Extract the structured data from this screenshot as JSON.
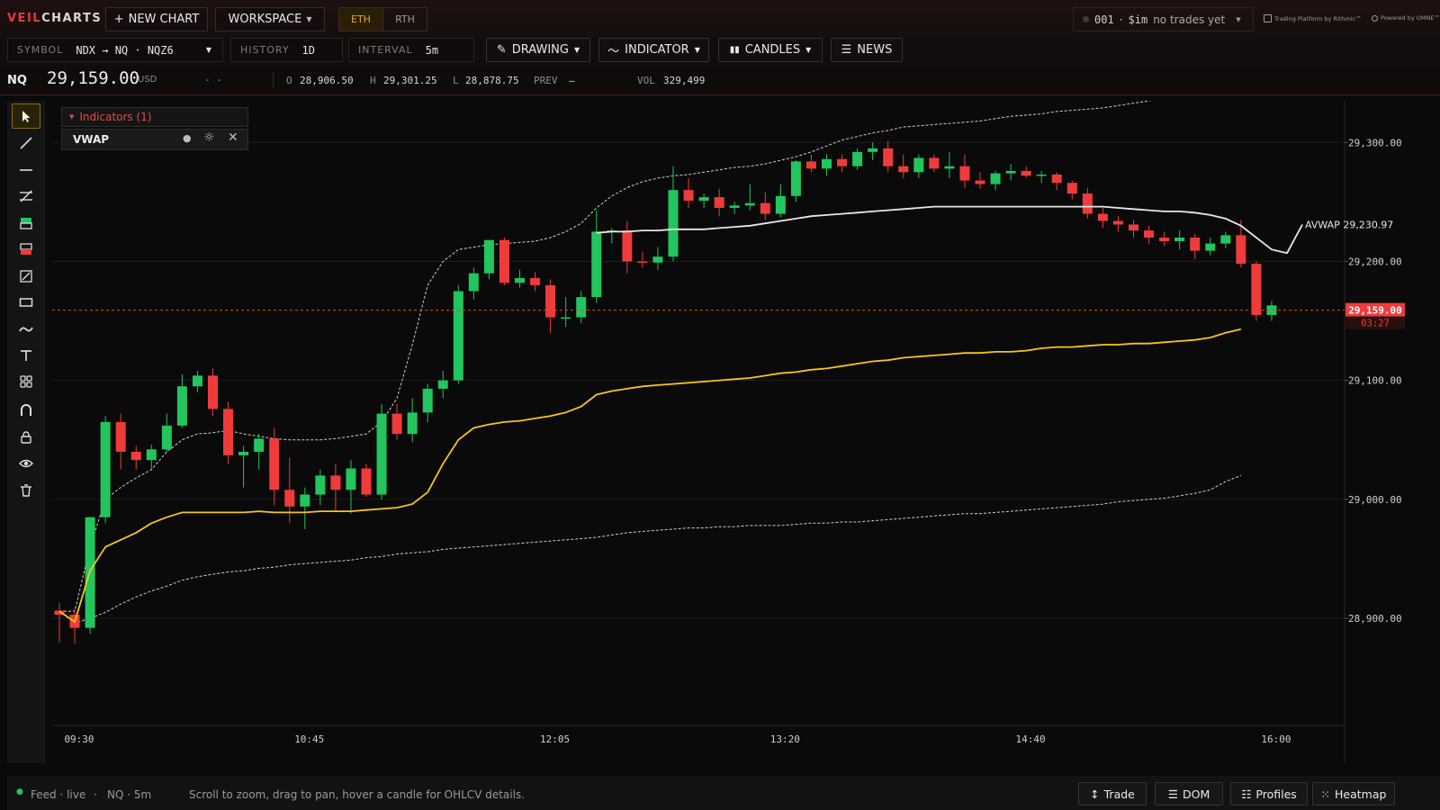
{
  "app": {
    "logo_accent": "VEIL",
    "logo_rest": "CHARTS"
  },
  "toolbar": {
    "new_chart": "NEW CHART",
    "workspace": "WORKSPACE",
    "session_eth": "ETH",
    "session_rth": "RTH",
    "account_id": "001",
    "account_sep": "·",
    "account_name": "$im",
    "account_status": "no trades yet",
    "brand_rithmic": "Trading Platform by Rithmic™",
    "brand_omne": "Powered by OMNE™"
  },
  "controls": {
    "symbol_label": "SYMBOL",
    "symbol_value": "NDX → NQ · NQZ6",
    "history_label": "HISTORY",
    "history_value": "1D",
    "interval_label": "INTERVAL",
    "interval_value": "5m",
    "drawing": "DRAWING",
    "indicator": "INDICATOR",
    "candles": "CANDLES",
    "news": "NEWS"
  },
  "quote": {
    "symbol": "NQ",
    "price": "29,159.00",
    "currency": "USD",
    "change": "- -",
    "o_label": "O",
    "o_value": "28,906.50",
    "h_label": "H",
    "h_value": "29,301.25",
    "l_label": "L",
    "l_value": "28,878.75",
    "prev_label": "PREV",
    "prev_value": "–",
    "vol_label": "VOL",
    "vol_value": "329,499"
  },
  "indicators": {
    "header": "Indicators (1)",
    "items": [
      {
        "name": "VWAP"
      }
    ]
  },
  "left_tools": [
    "cursor-icon",
    "trend-line-icon",
    "horizontal-line-icon",
    "parallel-channel-icon",
    "long-position-icon",
    "short-position-icon",
    "measure-icon",
    "rectangle-icon",
    "brush-icon",
    "text-icon",
    "patterns-icon",
    "magnet-icon",
    "lock-icon",
    "eye-icon",
    "trash-icon"
  ],
  "chart_data": {
    "type": "candlestick",
    "symbol": "NQ",
    "interval": "5m",
    "ylim": [
      28810,
      29335
    ],
    "y_ticks": [
      "29,300.00",
      "29,200.00",
      "29,100.00",
      "29,000.00",
      "28,900.00"
    ],
    "y_tick_values": [
      29300,
      29200,
      29100,
      29000,
      28900
    ],
    "x_ticks": [
      "09:30",
      "10:45",
      "12:05",
      "13:20",
      "14:40",
      "16:00"
    ],
    "last_price_label": "29,159.00",
    "last_price": 29159,
    "countdown": "03:27",
    "avwap_label": "AVWAP 29,230.97",
    "avwap_value": 29230.97,
    "candles": [
      [
        28906.5,
        28913,
        28880,
        28903
      ],
      [
        28903,
        28908,
        28878.75,
        28892
      ],
      [
        28892,
        28985,
        28887,
        28985
      ],
      [
        28985,
        29070,
        28980,
        29065
      ],
      [
        29065,
        29072,
        29025,
        29040
      ],
      [
        29040,
        29045,
        29025,
        29033
      ],
      [
        29033,
        29046,
        29025,
        29042
      ],
      [
        29042,
        29072,
        29040,
        29062
      ],
      [
        29062,
        29105,
        29060,
        29095
      ],
      [
        29095,
        29108,
        29090,
        29104
      ],
      [
        29104,
        29110,
        29070,
        29076
      ],
      [
        29076,
        29082,
        29030,
        29037
      ],
      [
        29037,
        29045,
        29010,
        29040
      ],
      [
        29040,
        29055,
        29025,
        29051
      ],
      [
        29051,
        29060,
        28995,
        29008
      ],
      [
        29008,
        29035,
        28980,
        28994
      ],
      [
        28994,
        29010,
        28975,
        29004
      ],
      [
        29004,
        29025,
        28995,
        29020
      ],
      [
        29020,
        29030,
        28990,
        29008
      ],
      [
        29008,
        29033,
        28988,
        29026
      ],
      [
        29026,
        29030,
        29002,
        29004
      ],
      [
        29004,
        29080,
        29000,
        29072
      ],
      [
        29072,
        29080,
        29050,
        29055
      ],
      [
        29055,
        29085,
        29048,
        29073
      ],
      [
        29073,
        29097,
        29065,
        29093
      ],
      [
        29093,
        29108,
        29085,
        29100
      ],
      [
        29100,
        29180,
        29097,
        29175
      ],
      [
        29175,
        29195,
        29168,
        29190
      ],
      [
        29190,
        29218,
        29185,
        29218
      ],
      [
        29218,
        29220,
        29180,
        29182
      ],
      [
        29182,
        29193,
        29178,
        29186
      ],
      [
        29186,
        29191,
        29175,
        29180
      ],
      [
        29180,
        29185,
        29140,
        29153
      ],
      [
        29153,
        29170,
        29145,
        29153
      ],
      [
        29153,
        29175,
        29148,
        29170
      ],
      [
        29170,
        29243,
        29165,
        29225
      ],
      [
        29225,
        29228,
        29215,
        29226
      ],
      [
        29226,
        29234,
        29190,
        29200
      ],
      [
        29200,
        29208,
        29195,
        29199
      ],
      [
        29199,
        29212,
        29193,
        29204
      ],
      [
        29204,
        29280,
        29200,
        29260
      ],
      [
        29260,
        29270,
        29245,
        29251
      ],
      [
        29251,
        29257,
        29245,
        29254
      ],
      [
        29254,
        29261,
        29238,
        29245
      ],
      [
        29245,
        29250,
        29240,
        29247
      ],
      [
        29247,
        29265,
        29243,
        29249
      ],
      [
        29249,
        29258,
        29235,
        29240
      ],
      [
        29240,
        29265,
        29237,
        29255
      ],
      [
        29255,
        29285,
        29250,
        29284
      ],
      [
        29284,
        29290,
        29275,
        29278
      ],
      [
        29278,
        29290,
        29272,
        29286
      ],
      [
        29286,
        29290,
        29275,
        29280
      ],
      [
        29280,
        29295,
        29277,
        29292
      ],
      [
        29292,
        29300,
        29285,
        29295
      ],
      [
        29295,
        29301.25,
        29275,
        29280
      ],
      [
        29280,
        29290,
        29270,
        29275
      ],
      [
        29275,
        29290,
        29270,
        29287
      ],
      [
        29287,
        29290,
        29275,
        29278
      ],
      [
        29278,
        29292,
        29270,
        29280
      ],
      [
        29280,
        29290,
        29262,
        29268
      ],
      [
        29268,
        29275,
        29261,
        29265
      ],
      [
        29265,
        29276,
        29260,
        29274
      ],
      [
        29274,
        29282,
        29268,
        29276
      ],
      [
        29276,
        29280,
        29270,
        29272
      ],
      [
        29272,
        29276,
        29266,
        29273
      ],
      [
        29273,
        29275,
        29260,
        29266
      ],
      [
        29266,
        29268,
        29252,
        29257
      ],
      [
        29257,
        29262,
        29236,
        29240
      ],
      [
        29240,
        29245,
        29228,
        29234
      ],
      [
        29234,
        29238,
        29225,
        29231
      ],
      [
        29231,
        29235,
        29220,
        29226
      ],
      [
        29226,
        29230,
        29215,
        29220
      ],
      [
        29220,
        29225,
        29213,
        29217
      ],
      [
        29217,
        29226,
        29210,
        29220
      ],
      [
        29220,
        29223,
        29202,
        29209
      ],
      [
        29209,
        29220,
        29205,
        29215
      ],
      [
        29215,
        29225,
        29211,
        29222
      ],
      [
        29222,
        29235,
        29195,
        29198
      ],
      [
        29198,
        29200,
        29150,
        29155
      ],
      [
        29155,
        29167,
        29150,
        29163
      ]
    ],
    "vwap": [
      28906,
      28897,
      28940,
      28960,
      28966,
      28972,
      28980,
      28985,
      28989,
      28989,
      28989,
      28989,
      28989,
      28990,
      28989,
      28989,
      28989,
      28990,
      28990,
      28990,
      28991,
      28992,
      28993,
      28996,
      29006,
      29030,
      29050,
      29060,
      29063,
      29065,
      29066,
      29068,
      29070,
      29073,
      29078,
      29088,
      29091,
      29093,
      29095,
      29096,
      29097,
      29098,
      29099,
      29100,
      29101,
      29102,
      29104,
      29106,
      29107,
      29109,
      29110,
      29112,
      29114,
      29116,
      29117,
      29119,
      29120,
      29121,
      29122,
      29123,
      29123,
      29124,
      29124,
      29125,
      29127,
      29128,
      29128,
      29129,
      29130,
      29130,
      29131,
      29131,
      29132,
      29133,
      29134,
      29136,
      29140,
      29143
    ],
    "vwap_upper": [
      28906,
      28906,
      28960,
      29000,
      29010,
      29018,
      29025,
      29040,
      29050,
      29055,
      29056,
      29058,
      29055,
      29053,
      29051,
      29050,
      29050,
      29050,
      29051,
      29053,
      29055,
      29065,
      29085,
      29130,
      29180,
      29200,
      29210,
      29212,
      29214,
      29215,
      29216,
      29217,
      29220,
      29225,
      29232,
      29245,
      29255,
      29262,
      29267,
      29270,
      29272,
      29273,
      29275,
      29277,
      29279,
      29280,
      29282,
      29285,
      29288,
      29292,
      29297,
      29302,
      29305,
      29308,
      29310,
      29313,
      29314,
      29315,
      29316,
      29317,
      29318,
      29320,
      29322,
      29323,
      29324,
      29326,
      29327,
      29328,
      29329,
      29331,
      29333,
      29335,
      29337,
      29339,
      29341,
      29342,
      29343,
      29342
    ],
    "vwap_lower": [
      28906,
      28896,
      28900,
      28905,
      28912,
      28918,
      28923,
      28927,
      28932,
      28935,
      28937,
      28939,
      28940,
      28942,
      28943,
      28945,
      28946,
      28947,
      28948,
      28949,
      28951,
      28952,
      28954,
      28955,
      28956,
      28958,
      28959,
      28960,
      28961,
      28962,
      28963,
      28964,
      28965,
      28966,
      28967,
      28968,
      28970,
      28972,
      28973,
      28974,
      28975,
      28976,
      28976,
      28977,
      28977,
      28978,
      28978,
      28978,
      28979,
      28980,
      28980,
      28981,
      28981,
      28982,
      28983,
      28984,
      28985,
      28986,
      28987,
      28988,
      28988,
      28989,
      28990,
      28991,
      28992,
      28993,
      28994,
      28995,
      28996,
      28998,
      28999,
      29000,
      29001,
      29003,
      29005,
      29008,
      29015,
      29020
    ],
    "avwap": [
      29224,
      29225,
      29225,
      29226,
      29226,
      29227,
      29227,
      29227,
      29228,
      29229,
      29230,
      29232,
      29234,
      29236,
      29238,
      29239,
      29240,
      29241,
      29242,
      29243,
      29244,
      29245,
      29246,
      29246,
      29246,
      29246,
      29246,
      29246,
      29246,
      29246,
      29246,
      29246,
      29246,
      29246,
      29245,
      29244,
      29243,
      29242,
      29242,
      29241,
      29239,
      29236,
      29230,
      29220,
      29210,
      29207,
      29231
    ]
  },
  "footer": {
    "feed": "Feed · live",
    "dot_sep": "·",
    "symbol_tf": "NQ · 5m",
    "hint": "Scroll to zoom, drag to pan, hover a candle for OHLCV details.",
    "btn_trade": "Trade",
    "btn_dom": "DOM",
    "btn_profiles": "Profiles",
    "btn_heatmap": "Heatmap"
  },
  "colors": {
    "up": "#22c55e",
    "down": "#ef3b3b",
    "vwap": "#f5c518",
    "avwap": "#e8e8e8",
    "accent": "#e5383b",
    "session": "#e2a43a"
  }
}
